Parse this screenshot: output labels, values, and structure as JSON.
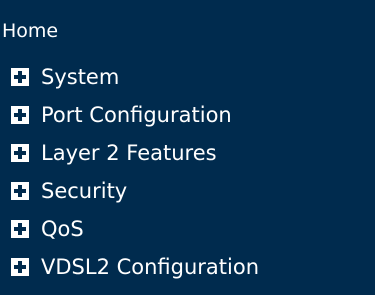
{
  "colors": {
    "background": "#002b4e",
    "text": "#ffffff"
  },
  "home": {
    "label": "Home"
  },
  "menu": {
    "items": [
      {
        "label": "System",
        "icon": "plus-box-icon"
      },
      {
        "label": "Port Configuration",
        "icon": "plus-box-icon"
      },
      {
        "label": "Layer 2 Features",
        "icon": "plus-box-icon"
      },
      {
        "label": "Security",
        "icon": "plus-box-icon"
      },
      {
        "label": "QoS",
        "icon": "plus-box-icon"
      },
      {
        "label": "VDSL2 Configuration",
        "icon": "plus-box-icon"
      }
    ]
  }
}
